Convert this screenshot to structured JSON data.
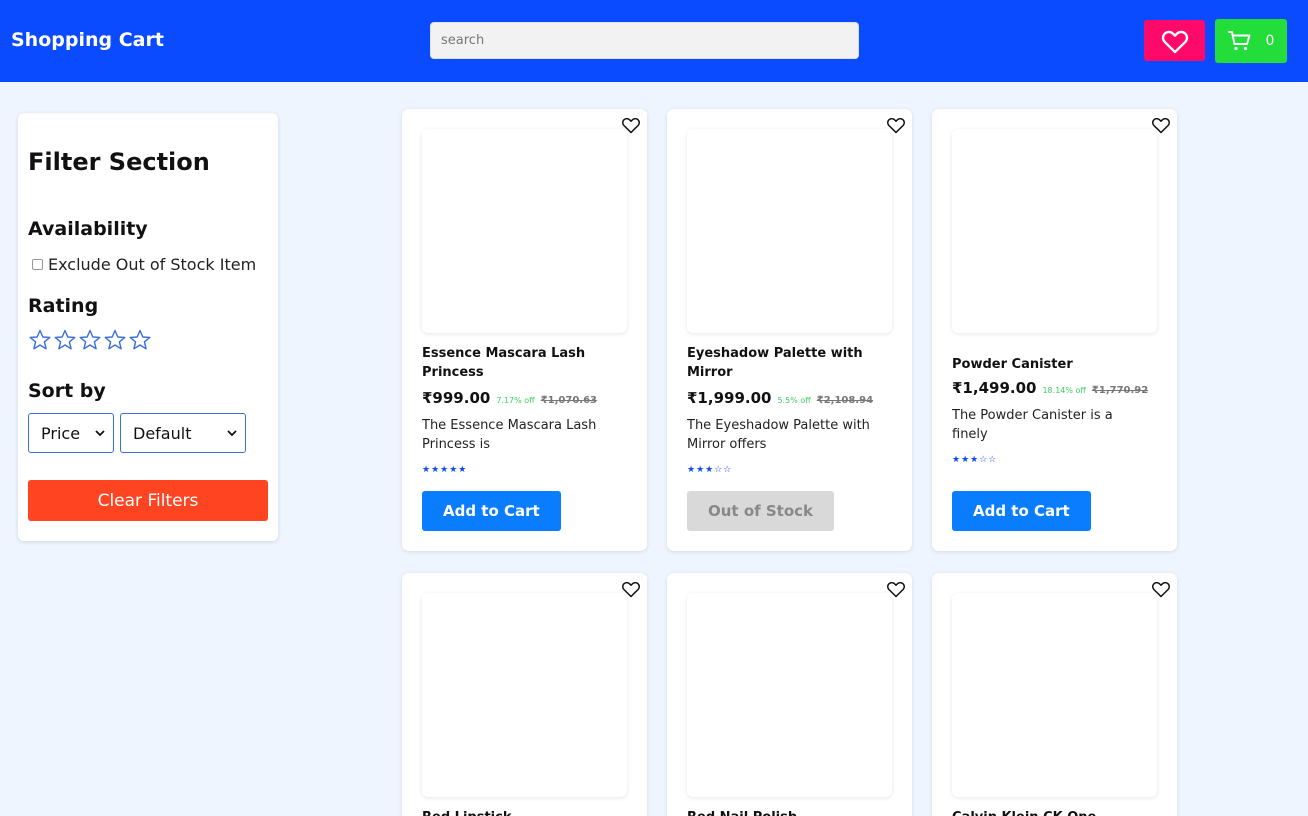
{
  "header": {
    "brand": "Shopping Cart",
    "search_placeholder": "search",
    "cart_count": "0",
    "colors": {
      "bar": "#0a4bff",
      "wishlist": "#ff0a6a",
      "cart": "#22dd3a"
    }
  },
  "filter": {
    "title": "Filter Section",
    "availability_heading": "Availability",
    "exclude_label": "Exclude Out of Stock Item",
    "exclude_checked": false,
    "rating_heading": "Rating",
    "rating_selected": 0,
    "sort_heading": "Sort by",
    "sort_field": "Price",
    "sort_order": "Default",
    "clear_label": "Clear Filters"
  },
  "products": [
    {
      "name": "Essence Mascara Lash Princess",
      "price": "₹999.00",
      "off": "7.17% off",
      "original": "₹1,070.63",
      "desc": "The Essence Mascara Lash Princess is",
      "rating": 5,
      "button": "Add to Cart",
      "in_stock": true
    },
    {
      "name": "Eyeshadow Palette with Mirror",
      "price": "₹1,999.00",
      "off": "5.5% off",
      "original": "₹2,108.94",
      "desc": "The Eyeshadow Palette with Mirror offers",
      "rating": 3,
      "button": "Out of Stock",
      "in_stock": false
    },
    {
      "name": "Powder Canister",
      "price": "₹1,499.00",
      "off": "18.14% off",
      "original": "₹1,770.92",
      "desc": "The Powder Canister is a finely",
      "rating": 3,
      "button": "Add to Cart",
      "in_stock": true
    },
    {
      "name": "Red Lipstick"
    },
    {
      "name": "Red Nail Polish"
    },
    {
      "name": "Calvin Klein CK One"
    }
  ]
}
